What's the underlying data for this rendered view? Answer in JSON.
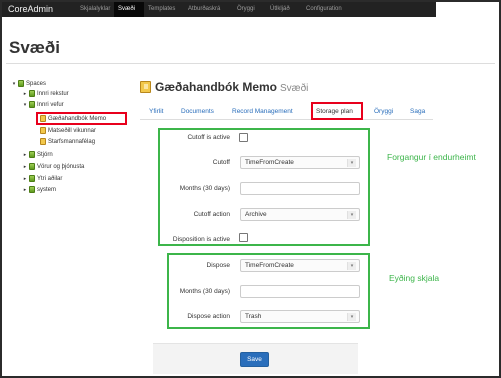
{
  "navbar": {
    "brand": "CoreAdmin",
    "items": [
      {
        "label": "Skjalalyklar"
      },
      {
        "label": "Svæði"
      },
      {
        "label": "Templates"
      },
      {
        "label": "Atburðaskrá"
      },
      {
        "label": "Öryggi"
      },
      {
        "label": "Útlkljáð"
      },
      {
        "label": "Configuration"
      }
    ],
    "active_index": 1
  },
  "page": {
    "title": "Svæði"
  },
  "tree": {
    "items": [
      {
        "label": "Spaces",
        "toggle": "▾",
        "icon": "database-icon",
        "level": 0
      },
      {
        "label": "Innri rekstur",
        "toggle": "▸",
        "icon": "database-icon",
        "level": 1
      },
      {
        "label": "Innri vefur",
        "toggle": "▾",
        "icon": "database-icon",
        "level": 1
      },
      {
        "label": "Gæðahandbók Memo",
        "toggle": "",
        "icon": "document-icon",
        "level": 2,
        "selected": true
      },
      {
        "label": "Matseðill vikunnar",
        "toggle": "",
        "icon": "document-icon",
        "level": 2
      },
      {
        "label": "Starfsmannafélag",
        "toggle": "",
        "icon": "document-icon",
        "level": 2
      },
      {
        "label": "Stjórn",
        "toggle": "▸",
        "icon": "database-icon",
        "level": 1
      },
      {
        "label": "Vörur og þjónusta",
        "toggle": "▸",
        "icon": "database-icon",
        "level": 1
      },
      {
        "label": "Ytri aðilar",
        "toggle": "▸",
        "icon": "database-icon",
        "level": 1
      },
      {
        "label": "system",
        "toggle": "▸",
        "icon": "database-icon",
        "level": 1
      }
    ]
  },
  "document": {
    "title": "Gæðahandbók Memo",
    "subtitle": "Svæði"
  },
  "tabs": [
    {
      "label": "Yfirlit"
    },
    {
      "label": "Documents"
    },
    {
      "label": "Record Management"
    },
    {
      "label": "Storage plan"
    },
    {
      "label": "Öryggi"
    },
    {
      "label": "Saga"
    }
  ],
  "active_tab_index": 3,
  "cutoff_section": {
    "note": "Forgangur í endurheimt",
    "cutoff_is_active_label": "Cutoff is active",
    "cutoff_is_active": false,
    "cutoff_label": "Cutoff",
    "cutoff_value": "TimeFromCreate",
    "months_label": "Months (30 days)",
    "months_value": "",
    "cutoff_action_label": "Cutoff action",
    "cutoff_action_value": "Archive",
    "disposition_active_label": "Disposition is active",
    "disposition_active": false
  },
  "dispose_section": {
    "note": "Eyðing skjala",
    "dispose_label": "Dispose",
    "dispose_value": "TimeFromCreate",
    "months_label": "Months (30 days)",
    "months_value": "",
    "dispose_action_label": "Dispose action",
    "dispose_action_value": "Trash"
  },
  "footer": {
    "save_label": "Save"
  },
  "colors": {
    "navbar_bg": "#222222",
    "highlight_red": "#e8001c",
    "section_green": "#3cb54a",
    "link_blue": "#2a6ebb",
    "primary_button": "#2a6ebb"
  }
}
